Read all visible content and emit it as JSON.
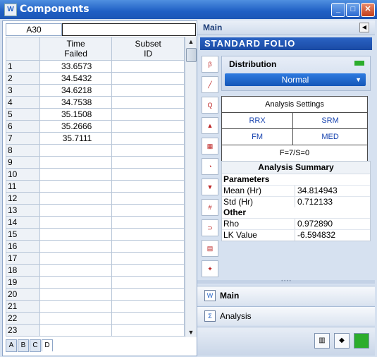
{
  "window": {
    "title": "Components",
    "app_icon": "W",
    "minimize": "_",
    "maximize": "□",
    "close": "✕"
  },
  "sheet": {
    "cell_ref": "A30",
    "formula": "",
    "columns": [
      "Time\nFailed",
      "Subset\nID"
    ],
    "col1": "Time Failed",
    "col2": "Subset ID",
    "rows": [
      {
        "n": "1",
        "time": "33.6573",
        "subset": ""
      },
      {
        "n": "2",
        "time": "34.5432",
        "subset": ""
      },
      {
        "n": "3",
        "time": "34.6218",
        "subset": ""
      },
      {
        "n": "4",
        "time": "34.7538",
        "subset": ""
      },
      {
        "n": "5",
        "time": "35.1508",
        "subset": ""
      },
      {
        "n": "6",
        "time": "35.2666",
        "subset": ""
      },
      {
        "n": "7",
        "time": "35.7111",
        "subset": ""
      },
      {
        "n": "8",
        "time": "",
        "subset": ""
      },
      {
        "n": "9",
        "time": "",
        "subset": ""
      },
      {
        "n": "10",
        "time": "",
        "subset": ""
      },
      {
        "n": "11",
        "time": "",
        "subset": ""
      },
      {
        "n": "12",
        "time": "",
        "subset": ""
      },
      {
        "n": "13",
        "time": "",
        "subset": ""
      },
      {
        "n": "14",
        "time": "",
        "subset": ""
      },
      {
        "n": "15",
        "time": "",
        "subset": ""
      },
      {
        "n": "16",
        "time": "",
        "subset": ""
      },
      {
        "n": "17",
        "time": "",
        "subset": ""
      },
      {
        "n": "18",
        "time": "",
        "subset": ""
      },
      {
        "n": "19",
        "time": "",
        "subset": ""
      },
      {
        "n": "20",
        "time": "",
        "subset": ""
      },
      {
        "n": "21",
        "time": "",
        "subset": ""
      },
      {
        "n": "22",
        "time": "",
        "subset": ""
      },
      {
        "n": "23",
        "time": "",
        "subset": ""
      }
    ],
    "tabs": [
      "A",
      "B",
      "C",
      "D"
    ]
  },
  "panel": {
    "header": "Main",
    "banner": "STANDARD FOLIO",
    "distribution_label": "Distribution",
    "distribution_value": "Normal",
    "analysis_settings": "Analysis Settings",
    "rrx": "RRX",
    "srm": "SRM",
    "fm": "FM",
    "med": "MED",
    "f_s": "F=7/S=0",
    "summary_title": "Analysis Summary",
    "parameters": "Parameters",
    "mean_label": "Mean (Hr)",
    "mean_value": "34.814943",
    "std_label": "Std (Hr)",
    "std_value": "0.712133",
    "other": "Other",
    "rho_label": "Rho",
    "rho_value": "0.972890",
    "lk_label": "LK Value",
    "lk_value": "-6.594832",
    "nav_main": "Main",
    "nav_analysis": "Analysis"
  },
  "icons": {
    "tool1": "distribution-wizard-icon",
    "tool2": "probability-plot-icon",
    "tool3": "qcp-calculator-icon",
    "tool4": "warning-mountain-icon",
    "tool5": "table-grid-icon",
    "tool6": "gauge-icon",
    "tool7": "filter-icon",
    "tool8": "numbers-icon",
    "tool9": "magnet-icon",
    "tool10": "report-icon",
    "tool11": "wizard-icon"
  }
}
